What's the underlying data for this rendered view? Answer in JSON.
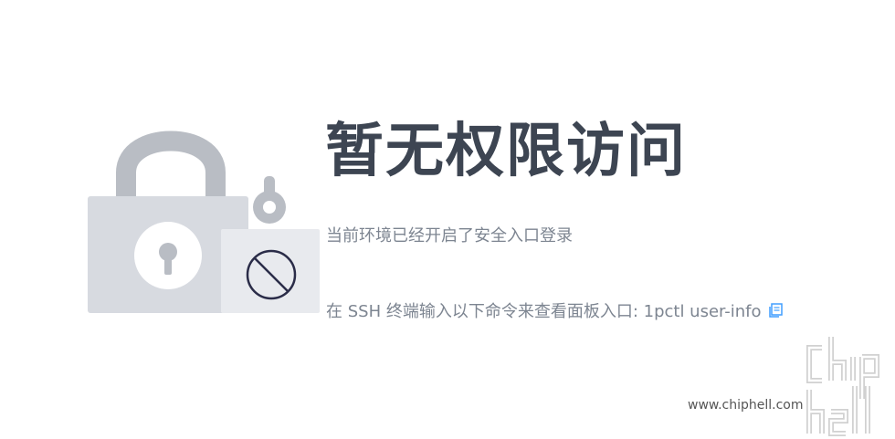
{
  "page": {
    "title": "暂无权限访问",
    "subtitle": "当前环境已经开启了安全入口登录",
    "hint": "在 SSH 终端输入以下命令来查看面板入口: 1pctl user-info"
  },
  "icons": {
    "lock": "lock-icon",
    "prohibited": "prohibited-icon",
    "copy": "copy-icon"
  },
  "watermark": {
    "url": "www.chiphell.com",
    "logo_text": "chip hell"
  },
  "colors": {
    "title": "#3d4552",
    "text": "#7d8591",
    "lock_body": "#d7dae0",
    "shackle": "#b9bdc4",
    "accent": "#409eff"
  }
}
